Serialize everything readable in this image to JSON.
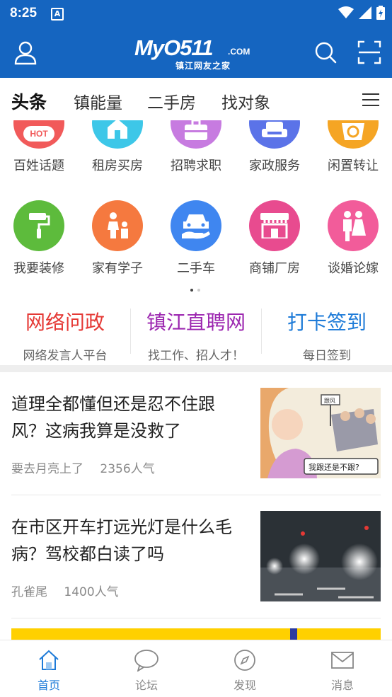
{
  "status_bar": {
    "time": "8:25",
    "notification_icon": "A"
  },
  "app_bar": {
    "logo_main": "MyO511",
    "logo_com": ".COM",
    "logo_sub": "镇江网友之家",
    "left_icon": "user-icon",
    "right_icons": [
      "search-icon",
      "scan-icon"
    ]
  },
  "tabs": [
    {
      "label": "头条",
      "active": true
    },
    {
      "label": "镇能量",
      "active": false
    },
    {
      "label": "二手房",
      "active": false
    },
    {
      "label": "找对象",
      "active": false
    }
  ],
  "menu_icon": "menu-icon",
  "services": [
    {
      "label": "百姓话题",
      "color": "#F15A5A",
      "icon": "hot-icon",
      "badge": "HOT"
    },
    {
      "label": "租房买房",
      "color": "#3DC7E8",
      "icon": "house-icon"
    },
    {
      "label": "招聘求职",
      "color": "#C77BE0",
      "icon": "briefcase-icon"
    },
    {
      "label": "家政服务",
      "color": "#5B73E8",
      "icon": "sofa-icon"
    },
    {
      "label": "闲置转让",
      "color": "#F5A524",
      "icon": "recycle-basket-icon"
    },
    {
      "label": "我要装修",
      "color": "#5DBB3C",
      "icon": "paint-roller-icon"
    },
    {
      "label": "家有学子",
      "color": "#F5793F",
      "icon": "parent-child-icon"
    },
    {
      "label": "二手车",
      "color": "#3F86F0",
      "icon": "car-hand-icon"
    },
    {
      "label": "商铺厂房",
      "color": "#E84B8F",
      "icon": "storefront-icon"
    },
    {
      "label": "谈婚论嫁",
      "color": "#F25C9A",
      "icon": "couple-icon"
    }
  ],
  "quick_links": [
    {
      "title": "网络问政",
      "subtitle": "网络发言人平台",
      "color": "#E53935"
    },
    {
      "title": "镇江直聘网",
      "subtitle": "找工作、招人才！",
      "color": "#9C27B0"
    },
    {
      "title": "打卡签到",
      "subtitle": "每日签到",
      "color": "#1E7BD8"
    }
  ],
  "articles": [
    {
      "title": "道理全都懂但还是忍不住跟风？这病我算是没救了",
      "author": "要去月亮上了",
      "popularity": "2356人气",
      "thumb_caption": "我跟还是不跟?",
      "thumb_sign": "跟风"
    },
    {
      "title": "在市区开车打远光灯是什么毛病？驾校都白读了吗",
      "author": "孔雀尾",
      "popularity": "1400人气"
    }
  ],
  "bottom_nav": [
    {
      "label": "首页",
      "icon": "home-icon",
      "active": true
    },
    {
      "label": "论坛",
      "icon": "chat-bubble-icon",
      "active": false
    },
    {
      "label": "发现",
      "icon": "compass-icon",
      "active": false
    },
    {
      "label": "消息",
      "icon": "mail-icon",
      "active": false
    }
  ],
  "colors": {
    "primary": "#1565C0",
    "accent": "#1E7BD8"
  }
}
